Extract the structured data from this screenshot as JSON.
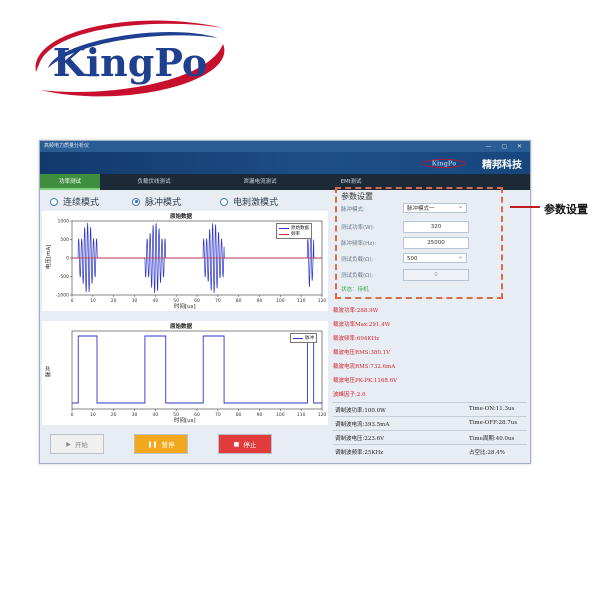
{
  "logo": {
    "text": "KingPo"
  },
  "window": {
    "title": "高频电力质量分析仪",
    "controls": [
      "—",
      "▢",
      "✕"
    ],
    "brand": "精邦科技",
    "mini_logo": "KingPo"
  },
  "tabs": [
    {
      "label": "功率测试",
      "active": true
    },
    {
      "label": "负载伏线测试",
      "active": false
    },
    {
      "label": "泄漏电流测试",
      "active": false
    },
    {
      "label": "EMI测试",
      "active": false
    }
  ],
  "modes": [
    {
      "label": "连续模式",
      "selected": false
    },
    {
      "label": "脉冲模式",
      "selected": true
    },
    {
      "label": "电刺激模式",
      "selected": false
    }
  ],
  "chart_data": [
    {
      "type": "line",
      "title": "原始数据",
      "xlabel": "时间[us]",
      "ylabel": "电压[mA]",
      "xlim": [
        0,
        120
      ],
      "ylim": [
        -1000,
        1000
      ],
      "x_ticks": [
        "0",
        "10",
        "20",
        "30",
        "40",
        "50",
        "60",
        "70",
        "80",
        "90",
        "100",
        "110",
        "120"
      ],
      "y_ticks": [
        "1000",
        "500",
        "0",
        "-500",
        "-1000"
      ],
      "legend": "top-right",
      "series": [
        {
          "name": "原始数据",
          "color": "#2c35c9",
          "bursts": [
            [
              3,
              12
            ],
            [
              35,
              45
            ],
            [
              63,
              73
            ],
            [
              113,
              116
            ]
          ],
          "amplitude": 950
        },
        {
          "name": "频率",
          "color": "#d22a2a",
          "value": 0
        }
      ]
    },
    {
      "type": "line",
      "title": "原始数据",
      "xlabel": "时间[us]",
      "ylabel": "脉冲",
      "xlim": [
        0,
        120
      ],
      "x_ticks": [
        "0",
        "10",
        "20",
        "30",
        "40",
        "50",
        "60",
        "70",
        "80",
        "90",
        "100",
        "110",
        "120"
      ],
      "y_ticks": [],
      "legend": "top-right",
      "series": [
        {
          "name": "脉冲",
          "color": "#2c35c9",
          "pulses": [
            [
              3,
              12
            ],
            [
              35,
              45
            ],
            [
              63,
              73
            ],
            [
              113,
              116
            ]
          ]
        }
      ]
    }
  ],
  "buttons": [
    {
      "label": "开始",
      "icon": "play-icon",
      "bg": "#f0f0f0",
      "fg": "#888888"
    },
    {
      "label": "暂停",
      "icon": "pause-icon",
      "bg": "#f3a81b",
      "fg": "#ffffff"
    },
    {
      "label": "停止",
      "icon": "stop-icon",
      "bg": "#e23b3b",
      "fg": "#ffffff"
    }
  ],
  "params": {
    "title": "参数设置",
    "status": "状态：待机",
    "fields": [
      {
        "label": "脉冲模式:",
        "value": "脉冲模式一",
        "kind": "select"
      },
      {
        "label": "测试功率(W):",
        "value": "320",
        "kind": "input"
      },
      {
        "label": "脉冲频率(Hz):",
        "value": "25000",
        "kind": "input"
      },
      {
        "label": "测试负载(Ω):",
        "value": "500",
        "kind": "select"
      },
      {
        "label": "测试负载(Ω):",
        "value": "0",
        "kind": "disabled"
      }
    ]
  },
  "results": [
    "载波功率:288.9W",
    "载波功率Max:291.4W",
    "载波频率:694KHz",
    "载波电压RMS:380.1V",
    "载波电流RMS:732.6mA",
    "载波电压PK-PK:1168.6V",
    "波峰因子:2.6"
  ],
  "modulation": [
    {
      "left": "调制波功率:100.0W",
      "right": "Time-ON:11.3us"
    },
    {
      "left": "调制波电流:393.5mA",
      "right": "Time-OFF:28.7us"
    },
    {
      "left": "调制波电压:223.6V",
      "right": "Time周期:40.0us"
    },
    {
      "left": "调制波频率:25KHz",
      "right": "占空比:28.4%"
    }
  ],
  "callout": {
    "label": "参数设置"
  },
  "colors": {
    "accent": "#1d4f87",
    "tab_active": "#3f8e3f",
    "result_red": "#d1242b"
  }
}
